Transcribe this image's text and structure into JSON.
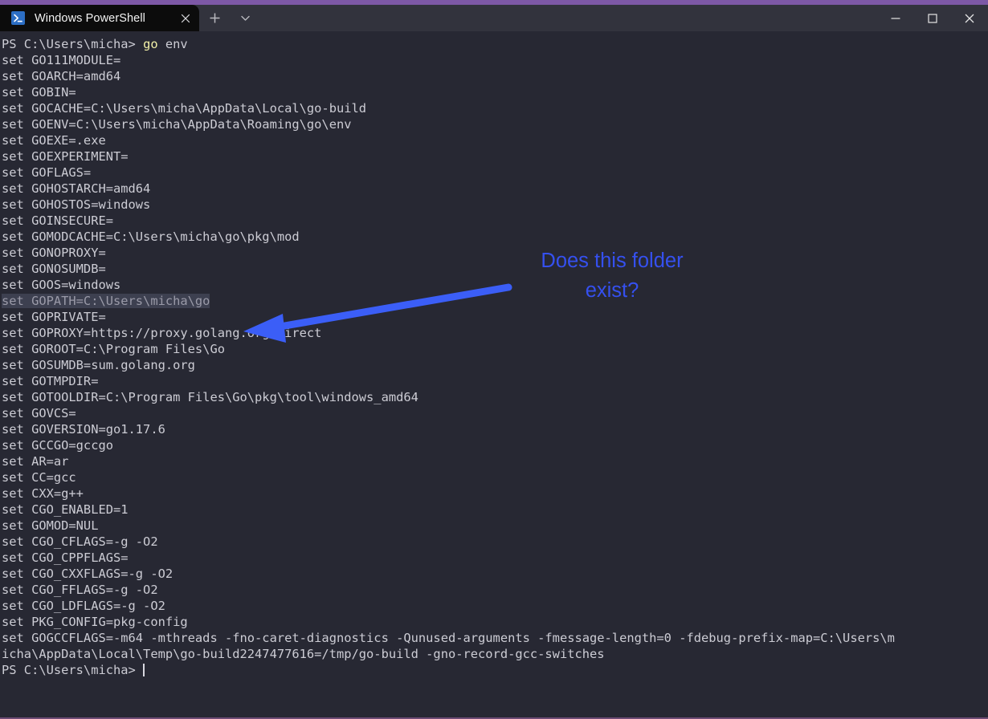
{
  "window": {
    "accent_color": "#7d58a6",
    "titlebar_bg": "#32333d",
    "tab": {
      "title": "Windows PowerShell",
      "icon": "powershell-icon",
      "close_glyph": "✕"
    },
    "new_tab_glyph": "+",
    "dropdown_glyph": "⌄",
    "controls": {
      "minimize_glyph": "─",
      "maximize_glyph": "□",
      "close_glyph": "✕"
    }
  },
  "terminal": {
    "background": "#272833",
    "foreground": "#ccccd4",
    "selection_background": "#3d4050",
    "prompt": "PS C:\\Users\\micha>",
    "command": "go env",
    "command_keyword": "go",
    "command_args": " env",
    "lines": [
      "set GO111MODULE=",
      "set GOARCH=amd64",
      "set GOBIN=",
      "set GOCACHE=C:\\Users\\micha\\AppData\\Local\\go-build",
      "set GOENV=C:\\Users\\micha\\AppData\\Roaming\\go\\env",
      "set GOEXE=.exe",
      "set GOEXPERIMENT=",
      "set GOFLAGS=",
      "set GOHOSTARCH=amd64",
      "set GOHOSTOS=windows",
      "set GOINSECURE=",
      "set GOMODCACHE=C:\\Users\\micha\\go\\pkg\\mod",
      "set GONOPROXY=",
      "set GONOSUMDB=",
      "set GOOS=windows"
    ],
    "selected_line": "set GOPATH=C:\\Users\\micha\\go",
    "lines_after": [
      "set GOPRIVATE=",
      "set GOPROXY=https://proxy.golang.org,direct",
      "set GOROOT=C:\\Program Files\\Go",
      "set GOSUMDB=sum.golang.org",
      "set GOTMPDIR=",
      "set GOTOOLDIR=C:\\Program Files\\Go\\pkg\\tool\\windows_amd64",
      "set GOVCS=",
      "set GOVERSION=go1.17.6",
      "set GCCGO=gccgo",
      "set AR=ar",
      "set CC=gcc",
      "set CXX=g++",
      "set CGO_ENABLED=1",
      "set GOMOD=NUL",
      "set CGO_CFLAGS=-g -O2",
      "set CGO_CPPFLAGS=",
      "set CGO_CXXFLAGS=-g -O2",
      "set CGO_FFLAGS=-g -O2",
      "set CGO_LDFLAGS=-g -O2",
      "set PKG_CONFIG=pkg-config",
      "set GOGCCFLAGS=-m64 -mthreads -fno-caret-diagnostics -Qunused-arguments -fmessage-length=0 -fdebug-prefix-map=C:\\Users\\m",
      "icha\\AppData\\Local\\Temp\\go-build2247477616=/tmp/go-build -gno-record-gcc-switches"
    ],
    "final_prompt": "PS C:\\Users\\micha> "
  },
  "annotation": {
    "text_line1": "Does this folder",
    "text_line2": "exist?",
    "color": "#3550ef",
    "arrow_color": "#3b5ef7",
    "arrow_from": "633,319",
    "arrow_to": "303,374"
  }
}
